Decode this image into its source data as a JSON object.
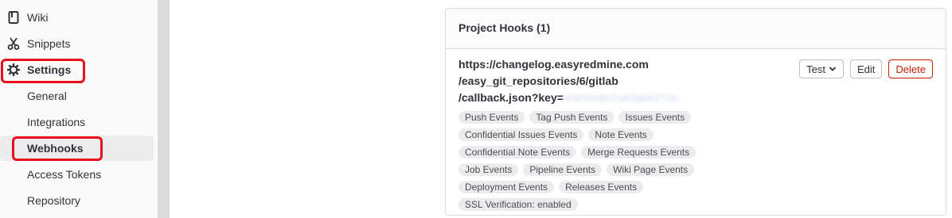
{
  "sidebar": {
    "items": [
      {
        "label": "Wiki",
        "icon": "book-icon"
      },
      {
        "label": "Snippets",
        "icon": "scissors-icon"
      },
      {
        "label": "Settings",
        "icon": "gear-icon"
      },
      {
        "label": "General"
      },
      {
        "label": "Integrations"
      },
      {
        "label": "Webhooks"
      },
      {
        "label": "Access Tokens"
      },
      {
        "label": "Repository"
      }
    ],
    "highlight_color": "#e8101a"
  },
  "hooks": {
    "header": "Project Hooks (1)",
    "url_lines": [
      "https://changelog.easyredmine.com",
      "/easy_git_repositories/6/gitlab",
      "/callback.json?key="
    ],
    "key_redacted": "hOKPS4BnTwP2qNKZTSn",
    "buttons": {
      "test": "Test",
      "edit": "Edit",
      "delete": "Delete"
    },
    "tag_rows": [
      [
        "Push Events",
        "Tag Push Events",
        "Issues Events"
      ],
      [
        "Confidential Issues Events",
        "Note Events"
      ],
      [
        "Confidential Note Events",
        "Merge Requests Events"
      ],
      [
        "Job Events",
        "Pipeline Events",
        "Wiki Page Events"
      ],
      [
        "Deployment Events",
        "Releases Events"
      ],
      [
        "SSL Verification: enabled"
      ]
    ]
  }
}
